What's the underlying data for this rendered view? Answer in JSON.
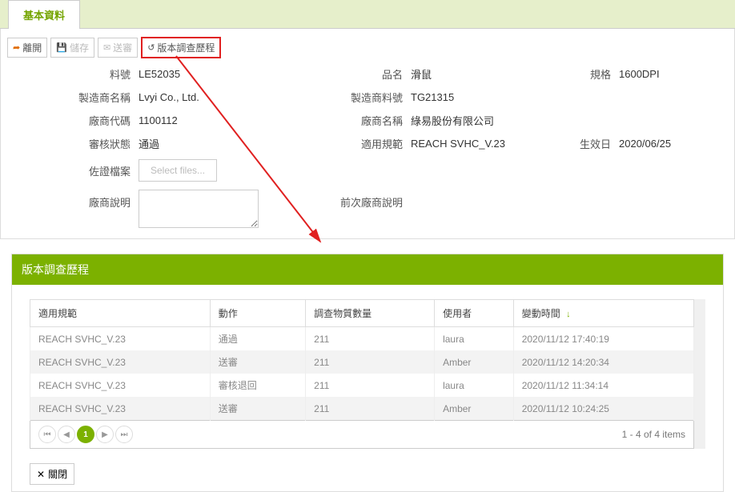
{
  "tab": {
    "label": "基本資料"
  },
  "toolbar": {
    "leave": "離開",
    "save": "儲存",
    "send": "送審",
    "history": "版本調查歷程"
  },
  "form": {
    "part_no_lbl": "料號",
    "part_no": "LE52035",
    "product_name_lbl": "品名",
    "product_name": "滑鼠",
    "spec_lbl": "規格",
    "spec": "1600DPI",
    "mfr_name_lbl": "製造商名稱",
    "mfr_name": "Lvyi Co., Ltd.",
    "mfr_part_lbl": "製造商料號",
    "mfr_part": "TG21315",
    "vendor_code_lbl": "廠商代碼",
    "vendor_code": "1100112",
    "vendor_name_lbl": "廠商名稱",
    "vendor_name": "綠易股份有限公司",
    "audit_status_lbl": "審核狀態",
    "audit_status": "通過",
    "regulation_lbl": "適用規範",
    "regulation": "REACH SVHC_V.23",
    "effective_lbl": "生效日",
    "effective": "2020/06/25",
    "attach_lbl": "佐證檔案",
    "file_placeholder": "Select files...",
    "vendor_desc_lbl": "廠商說明",
    "prev_vendor_desc_lbl": "前次廠商說明"
  },
  "popup": {
    "title": "版本調查歷程",
    "columns": {
      "regulation": "適用規範",
      "action": "動作",
      "count": "調查物質數量",
      "user": "使用者",
      "time": "變動時間"
    },
    "rows": [
      {
        "regulation": "REACH SVHC_V.23",
        "action": "通過",
        "count": "211",
        "user": "laura",
        "time": "2020/11/12 17:40:19"
      },
      {
        "regulation": "REACH SVHC_V.23",
        "action": "送審",
        "count": "211",
        "user": "Amber",
        "time": "2020/11/12 14:20:34"
      },
      {
        "regulation": "REACH SVHC_V.23",
        "action": "審核退回",
        "count": "211",
        "user": "laura",
        "time": "2020/11/12 11:34:14"
      },
      {
        "regulation": "REACH SVHC_V.23",
        "action": "送審",
        "count": "211",
        "user": "Amber",
        "time": "2020/11/12 10:24:25"
      }
    ],
    "pager": {
      "page": "1",
      "summary": "1 - 4 of 4 items"
    },
    "close": "關閉"
  }
}
